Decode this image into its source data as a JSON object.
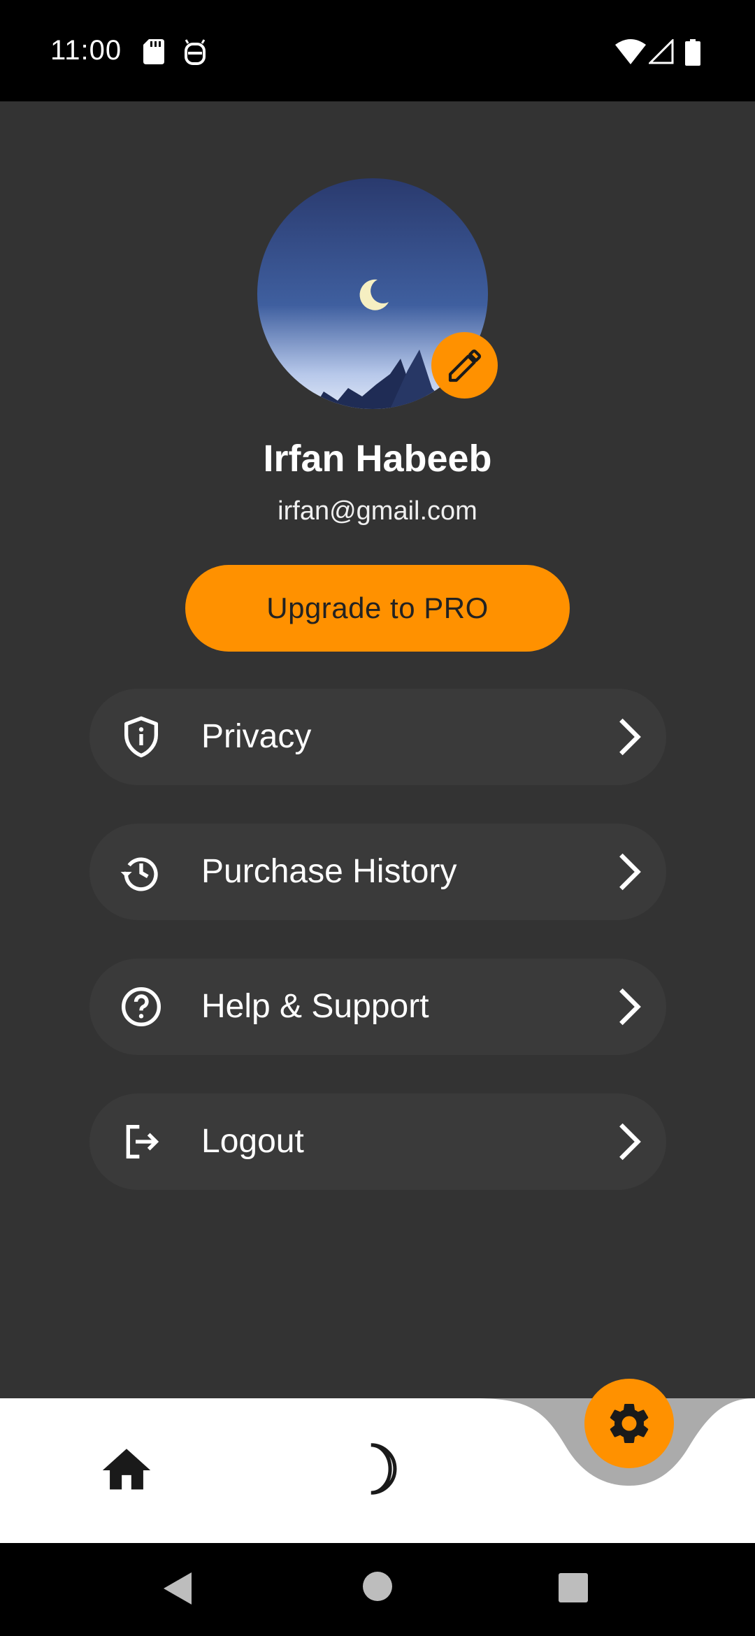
{
  "status_bar": {
    "time": "11:00",
    "icons": [
      "sd-card-icon",
      "android-debug-icon",
      "wifi-icon",
      "signal-icon",
      "battery-icon"
    ]
  },
  "profile": {
    "name": "Irfan Habeeb",
    "email": "irfan@gmail.com",
    "avatar_icon": "night-sky-moon-mountains-image",
    "edit_icon": "pencil-icon"
  },
  "upgrade_button": {
    "label": "Upgrade to PRO"
  },
  "menu": {
    "items": [
      {
        "label": "Privacy",
        "icon": "shield-info-icon"
      },
      {
        "label": "Purchase History",
        "icon": "history-icon"
      },
      {
        "label": "Help & Support",
        "icon": "help-circle-icon"
      },
      {
        "label": "Logout",
        "icon": "logout-icon"
      }
    ]
  },
  "bottom_nav": {
    "items": [
      {
        "icon": "home-icon"
      },
      {
        "icon": "moon-icon"
      },
      {
        "icon": "gear-icon",
        "active": true
      }
    ]
  },
  "colors": {
    "accent": "#ff9100",
    "background": "#333333",
    "card": "#3a3a3a",
    "nav_background": "#ffffff"
  }
}
